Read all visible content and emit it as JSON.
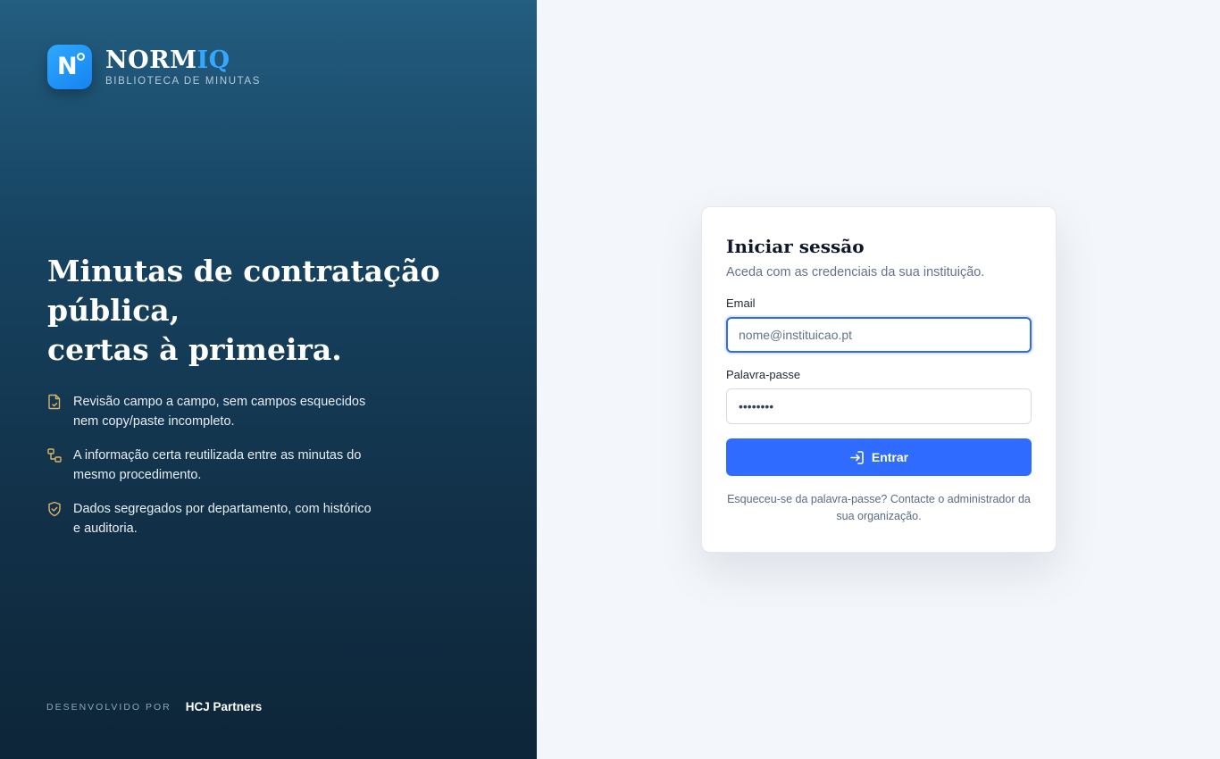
{
  "brand": {
    "logo_letter": "N",
    "name_main": "NORM",
    "name_accent": "IQ",
    "subtitle": "BIBLIOTECA DE MINUTAS",
    "accent_color": "#35a7ff"
  },
  "hero": {
    "line1": "Minutas de contratação",
    "line2": "pública,",
    "line3": "certas à primeira."
  },
  "features": [
    {
      "icon": "document-check-icon",
      "text": "Revisão campo a campo, sem campos esquecidos nem copy/paste incompleto."
    },
    {
      "icon": "link-nodes-icon",
      "text": "A informação certa reutilizada entre as minutas do mesmo procedimento."
    },
    {
      "icon": "shield-check-icon",
      "text": "Dados segregados por departamento, com histórico e auditoria."
    }
  ],
  "footer": {
    "developed_by": "DESENVOLVIDO POR",
    "company": "HCJ Partners"
  },
  "login": {
    "title": "Iniciar sessão",
    "subtitle": "Aceda com as credenciais da sua instituição.",
    "email_label": "Email",
    "email_placeholder": "nome@instituicao.pt",
    "email_value": "",
    "password_label": "Palavra-passe",
    "password_value": "••••••••",
    "submit_label": "Entrar",
    "submit_icon": "login-icon",
    "submit_color": "#2f6bff",
    "forgot_text": "Esqueceu-se da palavra-passe? Contacte o administrador da sua organização."
  }
}
